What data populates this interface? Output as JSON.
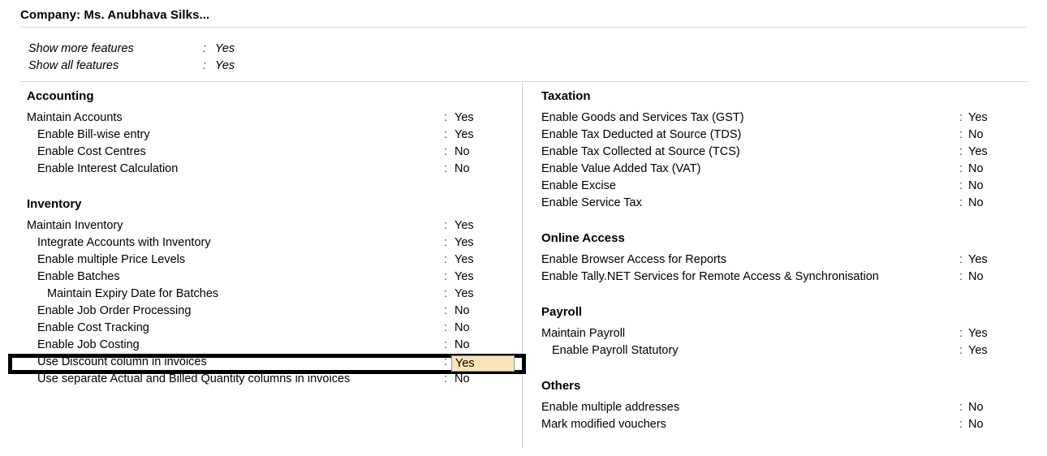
{
  "header": {
    "company_title": "Company: Ms. Anubhava Silks..."
  },
  "global_toggles": [
    {
      "label": "Show more features",
      "separator": ":",
      "value": "Yes"
    },
    {
      "label": "Show all features",
      "separator": ":",
      "value": "Yes"
    }
  ],
  "left_column": {
    "sections": [
      {
        "title": "Accounting",
        "options": [
          {
            "label": "Maintain Accounts",
            "separator": ":",
            "value": "Yes",
            "indent": 0
          },
          {
            "label": "Enable Bill-wise entry",
            "separator": ":",
            "value": "Yes",
            "indent": 1
          },
          {
            "label": "Enable Cost Centres",
            "separator": ":",
            "value": "No",
            "indent": 1
          },
          {
            "label": "Enable Interest Calculation",
            "separator": ":",
            "value": "No",
            "indent": 1
          }
        ]
      },
      {
        "title": "Inventory",
        "options": [
          {
            "label": "Maintain Inventory",
            "separator": ":",
            "value": "Yes",
            "indent": 0
          },
          {
            "label": "Integrate Accounts with Inventory",
            "separator": ":",
            "value": "Yes",
            "indent": 1
          },
          {
            "label": "Enable multiple Price Levels",
            "separator": ":",
            "value": "Yes",
            "indent": 1
          },
          {
            "label": "Enable Batches",
            "separator": ":",
            "value": "Yes",
            "indent": 1
          },
          {
            "label": "Maintain Expiry Date for Batches",
            "separator": ":",
            "value": "Yes",
            "indent": 2
          },
          {
            "label": "Enable Job Order Processing",
            "separator": ":",
            "value": "No",
            "indent": 1
          },
          {
            "label": "Enable Cost Tracking",
            "separator": ":",
            "value": "No",
            "indent": 1
          },
          {
            "label": "Enable Job Costing",
            "separator": ":",
            "value": "No",
            "indent": 1
          },
          {
            "label": "Use Discount column in invoices",
            "separator": ":",
            "value": "Yes",
            "indent": 1,
            "focused": true
          },
          {
            "label": "Use separate Actual and Billed Quantity columns in invoices",
            "separator": ":",
            "value": "No",
            "indent": 1
          }
        ]
      }
    ]
  },
  "right_column": {
    "sections": [
      {
        "title": "Taxation",
        "options": [
          {
            "label": "Enable Goods and Services Tax (GST)",
            "separator": ":",
            "value": "Yes",
            "indent": 0
          },
          {
            "label": "Enable Tax Deducted at Source (TDS)",
            "separator": ":",
            "value": "No",
            "indent": 0
          },
          {
            "label": "Enable Tax Collected at Source (TCS)",
            "separator": ":",
            "value": "Yes",
            "indent": 0
          },
          {
            "label": "Enable Value Added Tax (VAT)",
            "separator": ":",
            "value": "No",
            "indent": 0
          },
          {
            "label": "Enable Excise",
            "separator": ":",
            "value": "No",
            "indent": 0
          },
          {
            "label": "Enable Service Tax",
            "separator": ":",
            "value": "No",
            "indent": 0
          }
        ]
      },
      {
        "title": "Online Access",
        "options": [
          {
            "label": "Enable Browser Access for Reports",
            "separator": ":",
            "value": "Yes",
            "indent": 0
          },
          {
            "label": "Enable Tally.NET Services for Remote Access & Synchronisation",
            "separator": ":",
            "value": "No",
            "indent": 0
          }
        ]
      },
      {
        "title": "Payroll",
        "options": [
          {
            "label": "Maintain Payroll",
            "separator": ":",
            "value": "Yes",
            "indent": 0
          },
          {
            "label": "Enable Payroll Statutory",
            "separator": ":",
            "value": "Yes",
            "indent": 1
          }
        ]
      },
      {
        "title": "Others",
        "options": [
          {
            "label": "Enable multiple addresses",
            "separator": ":",
            "value": "No",
            "indent": 0
          },
          {
            "label": "Mark modified vouchers",
            "separator": ":",
            "value": "No",
            "indent": 0
          }
        ]
      }
    ]
  },
  "focused_field": {
    "value": "Yes",
    "background_color": "#fae4b7",
    "border_color": "#7ba099",
    "outline_color": "#000000"
  }
}
